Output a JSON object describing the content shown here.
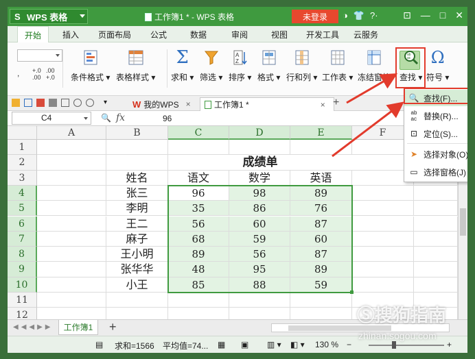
{
  "titlebar": {
    "app_name": "WPS 表格",
    "doc_title": "工作簿1 * - WPS 表格",
    "login": "未登录"
  },
  "menu": [
    "开始",
    "插入",
    "页面布局",
    "公式",
    "数据",
    "审阅",
    "视图",
    "开发工具",
    "云服务"
  ],
  "ribbon": {
    "cond_format": "条件格式",
    "table_style": "表格样式",
    "sum": "求和",
    "filter": "筛选",
    "sort": "排序",
    "format": "格式",
    "rowcol": "行和列",
    "worksheet": "工作表",
    "freeze": "冻结窗格",
    "find": "查找",
    "symbol": "符号"
  },
  "doc_tabs": {
    "mywps": "我的WPS",
    "workbook": "工作簿1 *"
  },
  "formula_bar": {
    "name_box": "C4",
    "fx": "fx",
    "value": "96"
  },
  "columns": [
    "A",
    "B",
    "C",
    "D",
    "E",
    "F"
  ],
  "rows": [
    "1",
    "2",
    "3",
    "4",
    "5",
    "6",
    "7",
    "8",
    "9",
    "10",
    "11",
    "12"
  ],
  "sheet": {
    "title": "成绩单",
    "headers": [
      "姓名",
      "语文",
      "数学",
      "英语"
    ],
    "names": [
      "张三",
      "李明",
      "王二",
      "麻子",
      "王小明",
      "张华华",
      "小王"
    ],
    "chinese": [
      "96",
      "35",
      "56",
      "68",
      "89",
      "48",
      "85"
    ],
    "math": [
      "98",
      "86",
      "60",
      "59",
      "56",
      "95",
      "88"
    ],
    "english": [
      "89",
      "76",
      "87",
      "60",
      "87",
      "89",
      "59"
    ]
  },
  "sheet_tabs": {
    "sheet1": "工作簿1"
  },
  "status": {
    "sum": "求和=1566",
    "avg": "平均值=74...",
    "zoom": "130 %"
  },
  "dropdown": {
    "find": "查找(F)...",
    "replace": "替换(R)...",
    "goto": "定位(S)...",
    "select_obj": "选择对象(O)",
    "select_pane": "选择窗格(J)"
  },
  "watermark": {
    "main": "搜狗指南",
    "url": "zhinan.sogou.com"
  },
  "colors": {
    "accent": "#3f9a3f",
    "highlight": "#e23b2c",
    "selection": "#e3f3e3"
  }
}
